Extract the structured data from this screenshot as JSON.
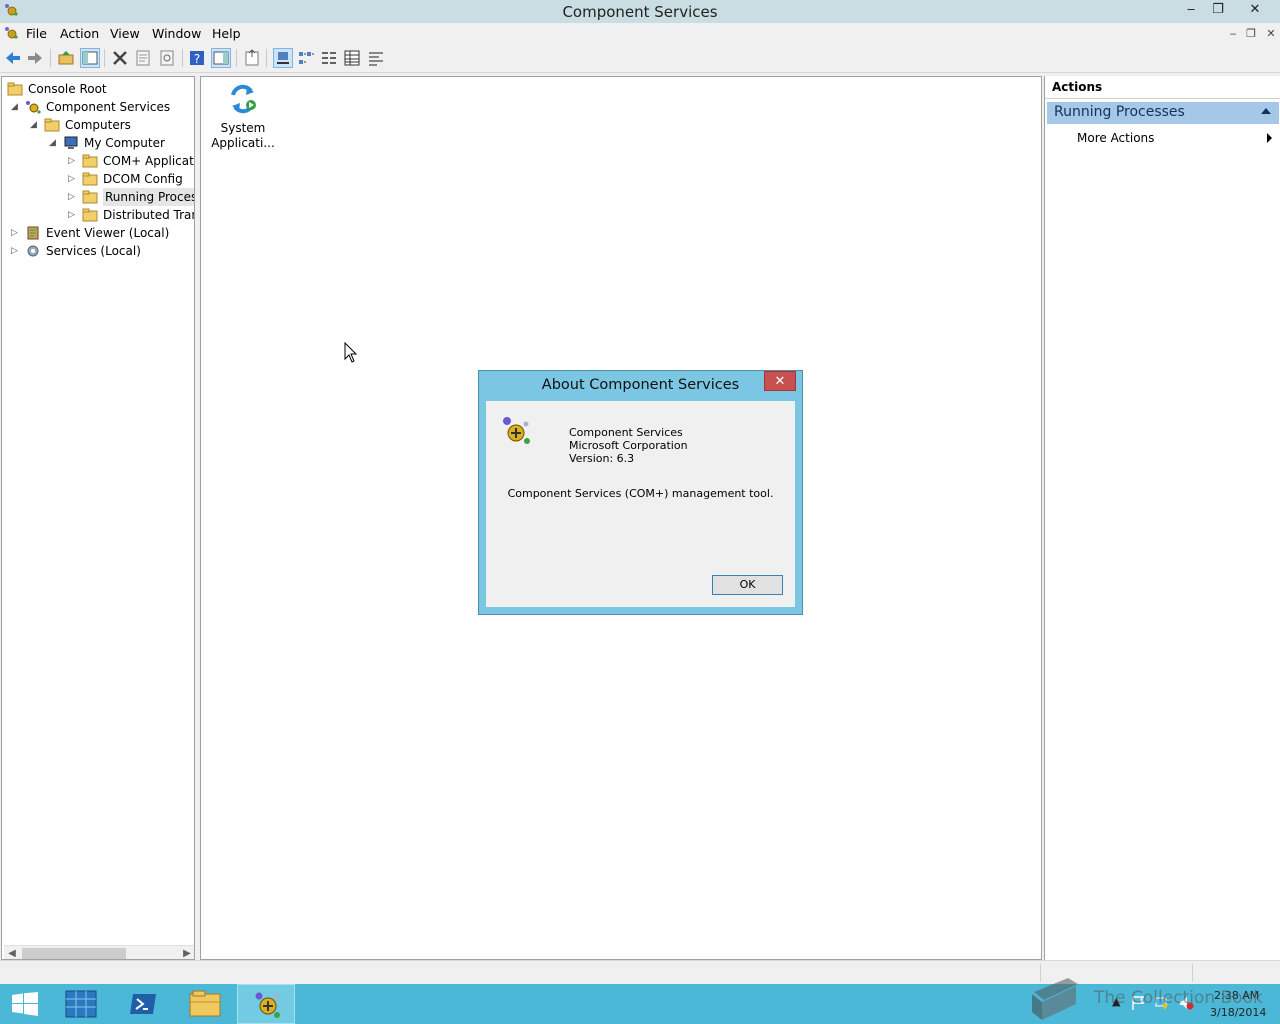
{
  "window": {
    "title": "Component Services",
    "controls": {
      "minimize": "‒",
      "restore": "❐",
      "close": "✕"
    }
  },
  "menu": [
    "File",
    "Action",
    "View",
    "Window",
    "Help"
  ],
  "toolbar_icons": [
    "back-icon",
    "forward-icon",
    "up-folder-icon",
    "show-hide-tree-icon",
    "delete-icon",
    "properties-icon",
    "refresh-icon",
    "help-icon",
    "show-action-pane-icon",
    "export-icon",
    "large-icons-view-icon",
    "small-icons-view-icon",
    "list-view-icon",
    "detail-view-icon",
    "status-view-icon"
  ],
  "tree": [
    {
      "label": "Console Root",
      "expander": "",
      "level": 0
    },
    {
      "label": "Component Services",
      "expander": "◢",
      "level": 1
    },
    {
      "label": "Computers",
      "expander": "◢",
      "level": 2
    },
    {
      "label": "My Computer",
      "expander": "◢",
      "level": 3
    },
    {
      "label": "COM+ Applicatio",
      "expander": "▷",
      "level": 4
    },
    {
      "label": "DCOM Config",
      "expander": "▷",
      "level": 4
    },
    {
      "label": "Running Processe",
      "expander": "▷",
      "level": 4,
      "selected": true
    },
    {
      "label": "Distributed Transa",
      "expander": "▷",
      "level": 4
    },
    {
      "label": "Event Viewer (Local)",
      "expander": "▷",
      "level": 1
    },
    {
      "label": "Services (Local)",
      "expander": "▷",
      "level": 1
    }
  ],
  "content": {
    "items": [
      {
        "label_line1": "System",
        "label_line2": "Applicati..."
      }
    ]
  },
  "actions": {
    "header": "Actions",
    "section": "Running Processes",
    "items": [
      "More Actions"
    ]
  },
  "dialog": {
    "title": "About Component Services",
    "close": "✕",
    "product": "Component Services",
    "company": "Microsoft Corporation",
    "version": "Version: 6.3",
    "description": "Component Services (COM+) management tool.",
    "ok": "OK"
  },
  "taskbar": {
    "time": "2:38 AM",
    "date": "3/18/2014",
    "watermark": "The Collection Book"
  },
  "colors": {
    "titlebar": "#c9dde3",
    "taskbar": "#4bb8d8",
    "dialog_frame": "#7ac6e3",
    "actions_section": "#a6c8e8",
    "close_button": "#c75050"
  }
}
